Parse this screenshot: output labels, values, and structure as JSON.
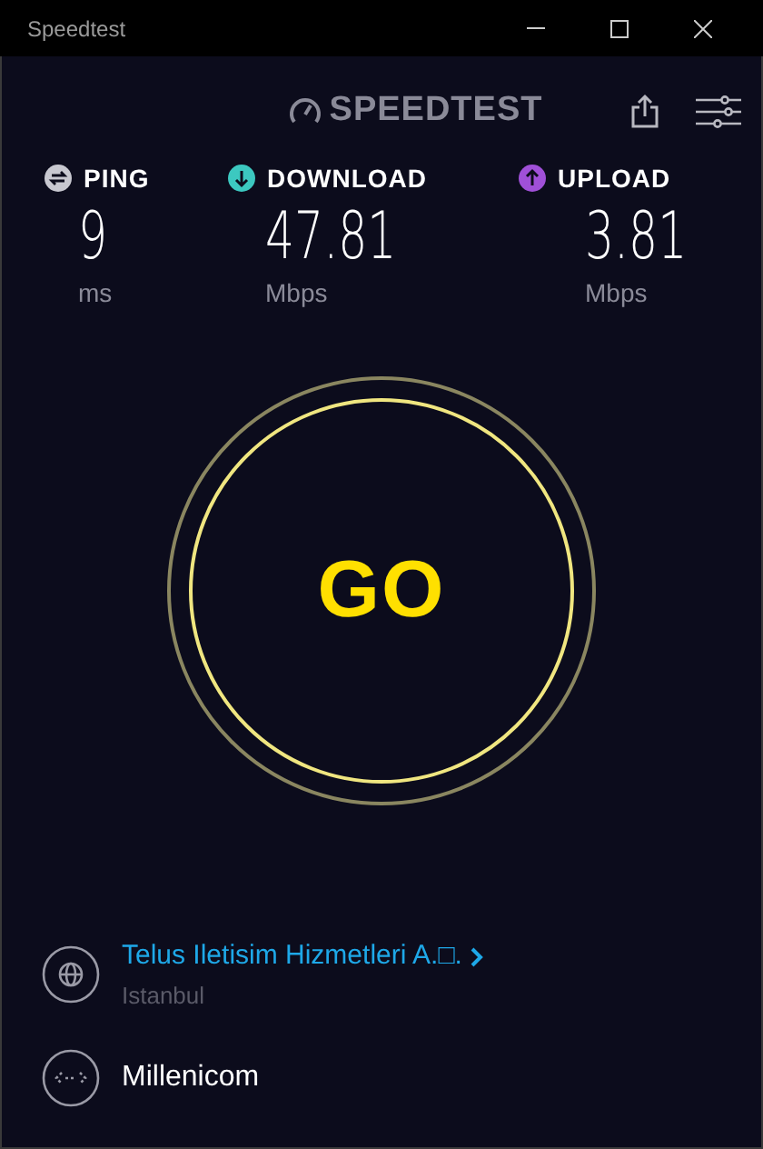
{
  "window": {
    "title": "Speedtest"
  },
  "logo": {
    "text": "SPEEDTEST"
  },
  "metrics": [
    {
      "kind": "ping",
      "label": "PING",
      "value": "9",
      "unit": "ms",
      "color": "#c8c8d0"
    },
    {
      "kind": "download",
      "label": "DOWNLOAD",
      "value": "47.81",
      "unit": "Mbps",
      "color": "#3cc8c0"
    },
    {
      "kind": "upload",
      "label": "UPLOAD",
      "value": "3.81",
      "unit": "Mbps",
      "color": "#a050d8"
    }
  ],
  "go_button": {
    "label": "GO"
  },
  "server": {
    "name": "Telus Iletisim Hizmetleri A.□.",
    "location": "Istanbul"
  },
  "provider": {
    "name": "Millenicom"
  }
}
